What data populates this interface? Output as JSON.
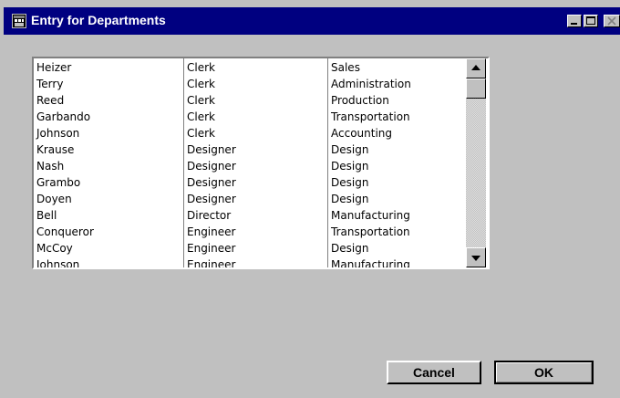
{
  "window": {
    "title": "Entry for Departments",
    "controls": {
      "minimize": "minimize-icon",
      "maximize": "maximize-icon",
      "close": "close-icon"
    },
    "titlebar_color": "#000080"
  },
  "list": {
    "rows": [
      {
        "name": "Heizer",
        "title": "Clerk",
        "department": "Sales"
      },
      {
        "name": "Terry",
        "title": "Clerk",
        "department": "Administration"
      },
      {
        "name": "Reed",
        "title": "Clerk",
        "department": "Production"
      },
      {
        "name": "Garbando",
        "title": "Clerk",
        "department": "Transportation"
      },
      {
        "name": "Johnson",
        "title": "Clerk",
        "department": "Accounting"
      },
      {
        "name": "Krause",
        "title": "Designer",
        "department": "Design"
      },
      {
        "name": "Nash",
        "title": "Designer",
        "department": "Design"
      },
      {
        "name": "Grambo",
        "title": "Designer",
        "department": "Design"
      },
      {
        "name": "Doyen",
        "title": "Designer",
        "department": "Design"
      },
      {
        "name": "Bell",
        "title": "Director",
        "department": "Manufacturing"
      },
      {
        "name": "Conqueror",
        "title": "Engineer",
        "department": "Transportation"
      },
      {
        "name": "McCoy",
        "title": "Engineer",
        "department": "Design"
      },
      {
        "name": "Johnson",
        "title": "Engineer",
        "department": "Manufacturing"
      }
    ],
    "scroll_position": 0
  },
  "buttons": {
    "cancel": "Cancel",
    "ok": "OK"
  }
}
